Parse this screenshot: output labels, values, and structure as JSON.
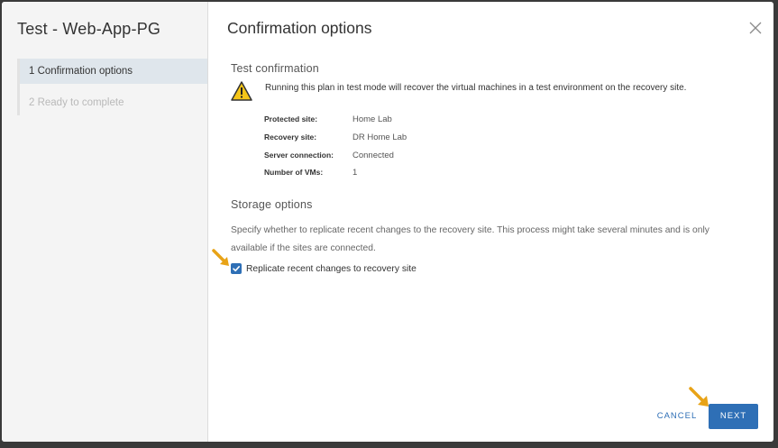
{
  "sidebar": {
    "title": "Test - Web-App-PG",
    "steps": [
      {
        "label": "1  Confirmation options"
      },
      {
        "label": "2  Ready to complete"
      }
    ]
  },
  "dialog": {
    "title": "Confirmation options",
    "close_icon": "close-icon"
  },
  "test_confirmation": {
    "heading": "Test confirmation",
    "warning_icon": "warning-icon",
    "warning_text": "Running this plan in test mode will recover the virtual machines in a test environment on the recovery site.",
    "details": [
      {
        "key": "Protected site:",
        "value": "Home Lab"
      },
      {
        "key": "Recovery site:",
        "value": "DR Home Lab"
      },
      {
        "key": "Server connection:",
        "value": "Connected"
      },
      {
        "key": "Number of VMs:",
        "value": "1"
      }
    ]
  },
  "storage_options": {
    "heading": "Storage options",
    "description": "Specify whether to replicate recent changes to the recovery site. This process might take several minutes and is only available if the sites are connected.",
    "checkbox_label": "Replicate recent changes to recovery site",
    "checkbox_checked": true
  },
  "footer": {
    "cancel_label": "CANCEL",
    "next_label": "NEXT"
  },
  "colors": {
    "accent": "#2e6fb6",
    "warning": "#f5c518",
    "annotation_arrow": "#e8a317"
  }
}
